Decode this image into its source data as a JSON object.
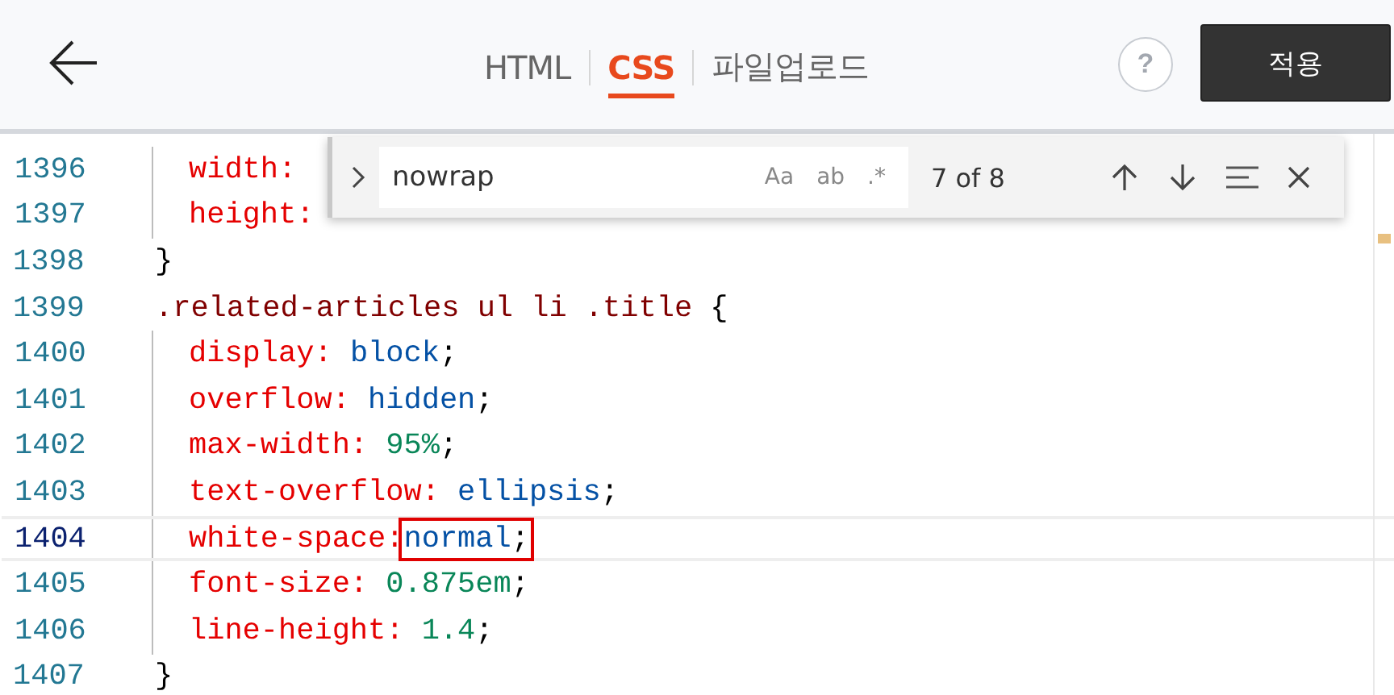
{
  "header": {
    "tabs": [
      {
        "label": "HTML",
        "selected": false
      },
      {
        "label": "CSS",
        "selected": true
      },
      {
        "label": "파일업로드",
        "selected": false
      }
    ],
    "help": "?",
    "apply_button": "적용"
  },
  "find_widget": {
    "query": "nowrap",
    "options": [
      "Aa",
      "ab",
      ".*"
    ],
    "count": "7 of 8"
  },
  "rules": [
    {
      "declarations": [
        {
          "number": "1396",
          "property": "width:",
          "spaced": true,
          "current": false,
          "boxed": false
        },
        {
          "number": "1397",
          "property": "height:",
          "spaced": true,
          "current": false,
          "boxed": false
        }
      ],
      "close": {
        "number": "1398",
        "text": "}"
      }
    },
    {
      "open": {
        "number": "1399",
        "selector": ".related-articles ul li .title",
        "brace": "{"
      },
      "declarations": [
        {
          "number": "1400",
          "property": "display:",
          "value": "block",
          "kind": "keyword",
          "end": ";",
          "spaced": true,
          "current": false,
          "boxed": false
        },
        {
          "number": "1401",
          "property": "overflow:",
          "value": "hidden",
          "kind": "keyword",
          "end": ";",
          "spaced": true,
          "current": false,
          "boxed": false
        },
        {
          "number": "1402",
          "property": "max-width:",
          "value": "95",
          "unit": "%",
          "kind": "number",
          "end": ";",
          "spaced": true,
          "current": false,
          "boxed": false
        },
        {
          "number": "1403",
          "property": "text-overflow:",
          "value": "ellipsis",
          "kind": "keyword",
          "end": ";",
          "spaced": true,
          "current": false,
          "boxed": false
        },
        {
          "number": "1404",
          "property": "white-space:",
          "value": "normal",
          "kind": "keyword",
          "end": ";",
          "spaced": false,
          "current": true,
          "boxed": true
        },
        {
          "number": "1405",
          "property": "font-size:",
          "value": "0.875",
          "unit": "em",
          "kind": "number",
          "end": ";",
          "spaced": true,
          "current": false,
          "boxed": false
        },
        {
          "number": "1406",
          "property": "line-height:",
          "value": "1.4",
          "kind": "number",
          "end": ";",
          "spaced": true,
          "current": false,
          "boxed": false
        }
      ],
      "close": {
        "number": "1407",
        "text": "}"
      }
    }
  ]
}
